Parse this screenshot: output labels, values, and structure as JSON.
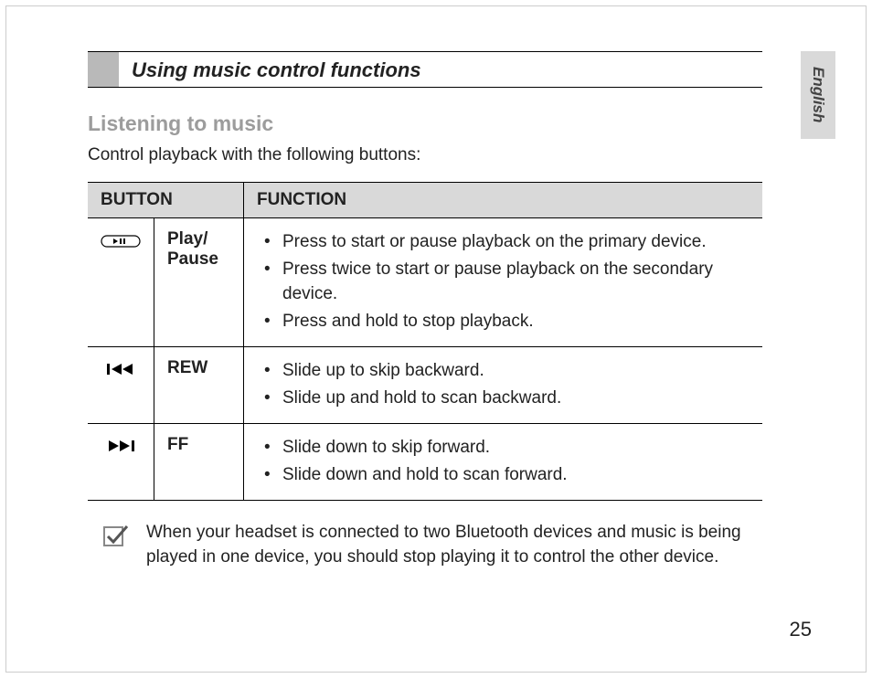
{
  "language_tab": "English",
  "section_title": "Using music control functions",
  "sub_heading": "Listening to music",
  "intro_text": "Control playback with the following buttons:",
  "table": {
    "header": {
      "button": "BUTTON",
      "function": "FUNCTION"
    },
    "rows": [
      {
        "icon": "play-pause-button-icon",
        "label": "Play/ Pause",
        "functions": [
          "Press to start or pause playback on the primary device.",
          "Press twice to start or pause playback on the secondary device.",
          "Press and hold to stop playback."
        ]
      },
      {
        "icon": "rewind-icon",
        "label": "REW",
        "functions": [
          "Slide up to skip backward.",
          "Slide up and hold to scan backward."
        ]
      },
      {
        "icon": "fast-forward-icon",
        "label": "FF",
        "functions": [
          "Slide down to skip forward.",
          "Slide down and hold to scan forward."
        ]
      }
    ]
  },
  "note_text": "When your headset is connected to two Bluetooth devices and music is being played in one device, you should stop playing it to control the other device.",
  "page_number": "25"
}
